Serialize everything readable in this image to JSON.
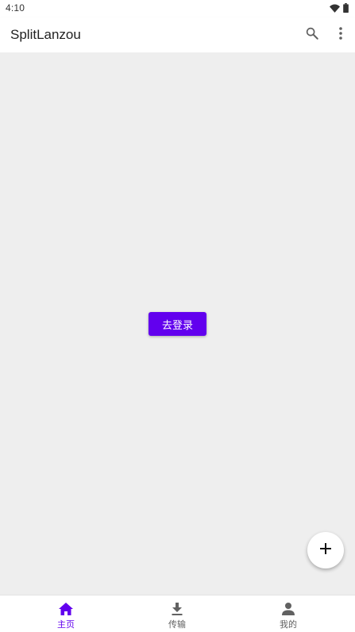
{
  "status_bar": {
    "time": "4:10",
    "icons": [
      "wifi-icon",
      "battery-icon"
    ]
  },
  "app_bar": {
    "title": "SplitLanzou",
    "actions": [
      "search-icon",
      "more-vert-icon"
    ]
  },
  "main": {
    "login_button_label": "去登录"
  },
  "fab": {
    "icon": "add-icon"
  },
  "bottom_nav": {
    "items": [
      {
        "label": "主页",
        "icon": "home-icon",
        "selected": true
      },
      {
        "label": "传输",
        "icon": "download-icon",
        "selected": false
      },
      {
        "label": "我的",
        "icon": "person-icon",
        "selected": false
      }
    ]
  },
  "colors": {
    "accent": "#6200ee",
    "background": "#eeeeee",
    "surface": "#ffffff",
    "inactive": "#616161"
  }
}
